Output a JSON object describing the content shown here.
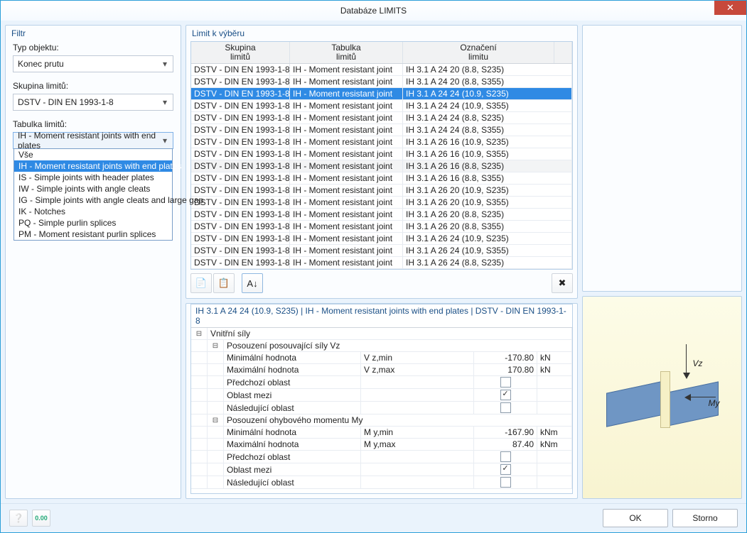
{
  "window": {
    "title": "Databáze LIMITS"
  },
  "filter": {
    "title": "Filtr",
    "objectType_label": "Typ objektu:",
    "objectType_value": "Konec prutu",
    "group_label": "Skupina limitů:",
    "group_value": "DSTV - DIN EN 1993-1-8",
    "table_label": "Tabulka limitů:",
    "table_value": "IH - Moment resistant joints with end plates",
    "table_options": [
      "Vše",
      "IH - Moment resistant joints with end plates",
      "IS - Simple joints with header plates",
      "IW - Simple joints with angle cleats",
      "IG - Simple joints with angle cleats and large gap",
      "IK - Notches",
      "PQ - Simple purlin splices",
      "PM - Moment resistant purlin splices"
    ]
  },
  "grid": {
    "title": "Limit k výběru",
    "hdr": {
      "c1a": "Skupina",
      "c1b": "limitů",
      "c2a": "Tabulka",
      "c2b": "limitů",
      "c3a": "Označení",
      "c3b": "limitu"
    },
    "rows": [
      {
        "g": "DSTV - DIN EN 1993-1-8",
        "t": "IH - Moment resistant joint",
        "d": "IH 3.1 A 24 20 (8.8, S235)"
      },
      {
        "g": "DSTV - DIN EN 1993-1-8",
        "t": "IH - Moment resistant joint",
        "d": "IH 3.1 A 24 20 (8.8, S355)"
      },
      {
        "g": "DSTV - DIN EN 1993-1-8",
        "t": "IH - Moment resistant joint",
        "d": "IH 3.1 A 24 24 (10.9, S235)",
        "sel": true
      },
      {
        "g": "DSTV - DIN EN 1993-1-8",
        "t": "IH - Moment resistant joint",
        "d": "IH 3.1 A 24 24 (10.9, S355)"
      },
      {
        "g": "DSTV - DIN EN 1993-1-8",
        "t": "IH - Moment resistant joint",
        "d": "IH 3.1 A 24 24 (8.8, S235)"
      },
      {
        "g": "DSTV - DIN EN 1993-1-8",
        "t": "IH - Moment resistant joint",
        "d": "IH 3.1 A 24 24 (8.8, S355)"
      },
      {
        "g": "DSTV - DIN EN 1993-1-8",
        "t": "IH - Moment resistant joint",
        "d": "IH 3.1 A 26 16 (10.9, S235)"
      },
      {
        "g": "DSTV - DIN EN 1993-1-8",
        "t": "IH - Moment resistant joint",
        "d": "IH 3.1 A 26 16 (10.9, S355)"
      },
      {
        "g": "DSTV - DIN EN 1993-1-8",
        "t": "IH - Moment resistant joint",
        "d": "IH 3.1 A 26 16 (8.8, S235)",
        "alt": true
      },
      {
        "g": "DSTV - DIN EN 1993-1-8",
        "t": "IH - Moment resistant joint",
        "d": "IH 3.1 A 26 16 (8.8, S355)"
      },
      {
        "g": "DSTV - DIN EN 1993-1-8",
        "t": "IH - Moment resistant joint",
        "d": "IH 3.1 A 26 20 (10.9, S235)"
      },
      {
        "g": "DSTV - DIN EN 1993-1-8",
        "t": "IH - Moment resistant joint",
        "d": "IH 3.1 A 26 20 (10.9, S355)"
      },
      {
        "g": "DSTV - DIN EN 1993-1-8",
        "t": "IH - Moment resistant joint",
        "d": "IH 3.1 A 26 20 (8.8, S235)"
      },
      {
        "g": "DSTV - DIN EN 1993-1-8",
        "t": "IH - Moment resistant joint",
        "d": "IH 3.1 A 26 20 (8.8, S355)"
      },
      {
        "g": "DSTV - DIN EN 1993-1-8",
        "t": "IH - Moment resistant joint",
        "d": "IH 3.1 A 26 24 (10.9, S235)"
      },
      {
        "g": "DSTV - DIN EN 1993-1-8",
        "t": "IH - Moment resistant joint",
        "d": "IH 3.1 A 26 24 (10.9, S355)"
      },
      {
        "g": "DSTV - DIN EN 1993-1-8",
        "t": "IH - Moment resistant joint",
        "d": "IH 3.1 A 26 24 (8.8, S235)"
      }
    ]
  },
  "props": {
    "title": "IH 3.1 A 24 24 (10.9, S235) | IH - Moment resistant joints with end plates | DSTV - DIN EN 1993-1-8",
    "header": "Vnitřní síly",
    "sec1": "Posouzení posouvající síly Vz",
    "r1": {
      "name": "Minimální hodnota",
      "sym": "V z,min",
      "val": "-170.80",
      "unit": "kN"
    },
    "r2": {
      "name": "Maximální hodnota",
      "sym": "V z,max",
      "val": "170.80",
      "unit": "kN"
    },
    "r3": {
      "name": "Předchozí oblast",
      "chk": false
    },
    "r4": {
      "name": "Oblast mezi",
      "chk": true,
      "alt": true
    },
    "r5": {
      "name": "Následující oblast",
      "chk": false
    },
    "sec2": "Posouzení ohybového momentu My",
    "r6": {
      "name": "Minimální hodnota",
      "sym": "M y,min",
      "val": "-167.90",
      "unit": "kNm"
    },
    "r7": {
      "name": "Maximální hodnota",
      "sym": "M y,max",
      "val": "87.40",
      "unit": "kNm"
    },
    "r8": {
      "name": "Předchozí oblast",
      "chk": false
    },
    "r9": {
      "name": "Oblast mezi",
      "chk": true
    },
    "r10": {
      "name": "Následující oblast",
      "chk": false
    }
  },
  "preview": {
    "vz": "Vz",
    "my": "My"
  },
  "footer": {
    "ok": "OK",
    "cancel": "Storno"
  }
}
